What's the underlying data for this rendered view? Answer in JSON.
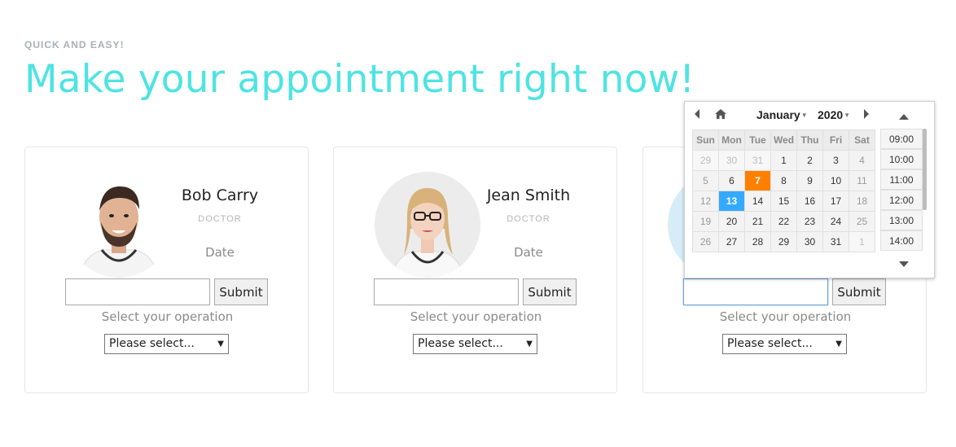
{
  "header": {
    "eyebrow": "QUICK AND EASY!",
    "title": "Make your appointment right now!"
  },
  "doctors": [
    {
      "name": "Bob Carry",
      "role": "DOCTOR",
      "date_label": "Date",
      "date_value": "",
      "submit_label": "Submit",
      "operation_label": "Select your operation",
      "operation_selected": "Please select..."
    },
    {
      "name": "Jean Smith",
      "role": "DOCTOR",
      "date_label": "Date",
      "date_value": "",
      "submit_label": "Submit",
      "operation_label": "Select your operation",
      "operation_selected": "Please select..."
    },
    {
      "name": "",
      "role": "",
      "date_label": "",
      "date_value": "",
      "submit_label": "Submit",
      "operation_label": "Select your operation",
      "operation_selected": "Please select..."
    }
  ],
  "datepicker": {
    "month": "January",
    "year": "2020",
    "weekdays": [
      "Sun",
      "Mon",
      "Tue",
      "Wed",
      "Thu",
      "Fri",
      "Sat"
    ],
    "weeks": [
      [
        "29",
        "30",
        "31",
        "1",
        "2",
        "3",
        "4"
      ],
      [
        "5",
        "6",
        "7",
        "8",
        "9",
        "10",
        "11"
      ],
      [
        "12",
        "13",
        "14",
        "15",
        "16",
        "17",
        "18"
      ],
      [
        "19",
        "20",
        "21",
        "22",
        "23",
        "24",
        "25"
      ],
      [
        "26",
        "27",
        "28",
        "29",
        "30",
        "31",
        "1"
      ]
    ],
    "selected_day": "7",
    "today_day": "13",
    "times": [
      "09:00",
      "10:00",
      "11:00",
      "12:00",
      "13:00",
      "14:00"
    ]
  },
  "colors": {
    "accent": "#4fe3e3",
    "selected": "#ff8000",
    "today": "#33aaff"
  }
}
